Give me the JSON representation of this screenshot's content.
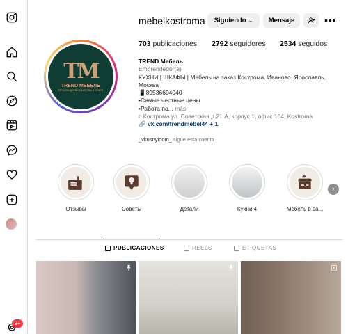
{
  "profile": {
    "username": "mebelkostroma",
    "following_label": "Siguiendo",
    "message_label": "Mensaje",
    "more_label": "•••",
    "posts_count": "703",
    "posts_label": "publicaciones",
    "followers_count": "2792",
    "followers_label": "seguidores",
    "following_count": "2534",
    "following_count_label": "seguidos",
    "logo_mark": "TM",
    "logo_text": "TREND МЕБЕЛЬ",
    "logo_sub": "ПРОИЗВОДСТВО КАЧЕСТВА И СТИЛЯ"
  },
  "bio": {
    "name": "TREND Мебель",
    "category": "Emprendedor(a)",
    "line1": "КУХНИ | ШКАФЫ | Мебель на заказ Кострома. Иваново. Ярославль. Москва",
    "phone": "📱89536694040",
    "line3": "•Самые честные цены",
    "line4": "•Работа по...",
    "more": "más",
    "address": "г. Кострома ул. Советская д.21 А, корпус 1, офис 104, Kostroma",
    "link": "vk.com/trendmebel44 + 1",
    "followed_user": "_vkusnyidom_",
    "followed_suffix": "sigue esta cuenta"
  },
  "highlights": [
    {
      "label": "Отзывы",
      "icon": "thumbs-up-icon"
    },
    {
      "label": "Советы",
      "icon": "lightbulb-icon"
    },
    {
      "label": "Детали",
      "icon": "kitchen-photo"
    },
    {
      "label": "Кухни 4",
      "icon": "kitchen-photo"
    },
    {
      "label": "Мебель в ва...",
      "icon": "sink-cabinet-icon"
    }
  ],
  "tabs": [
    {
      "label": "PUBLICACIONES",
      "active": true
    },
    {
      "label": "REELS",
      "active": false
    },
    {
      "label": "ETIQUETAS",
      "active": false
    }
  ],
  "nav": {
    "notification_badge": "9+"
  },
  "colors": {
    "brand_green": "#0f3d34",
    "brand_gold": "#c9a27a",
    "link": "#00376b",
    "badge": "#ff3040"
  }
}
